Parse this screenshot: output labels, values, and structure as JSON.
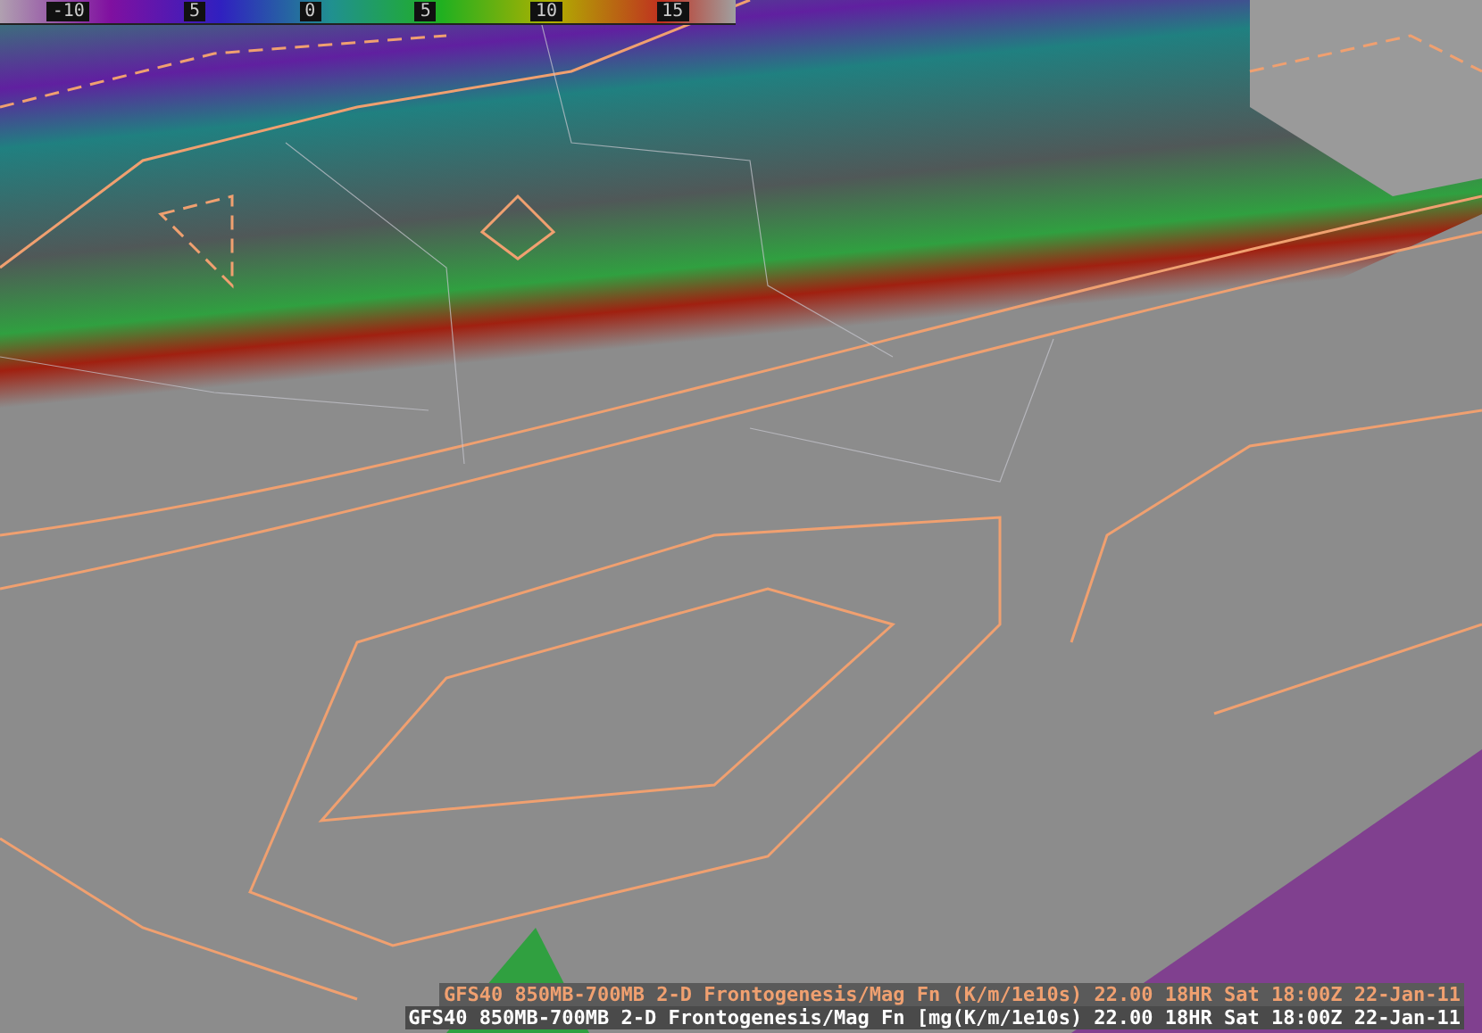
{
  "colorbar": {
    "labels": [
      "-10",
      "5",
      "0",
      "5",
      "10",
      "15"
    ]
  },
  "caption": {
    "ghost": "GFS40 850MB-700MB 2-D Frontogenesis/Mag Fn (K/m/1e10s)  22.00  18HR Sat 18:00Z 22-Jan-11",
    "title": "GFS40 850MB-700MB 2-D Frontogenesis/Mag Fn [mg(K/m/1e10s)  22.00  18HR Sat 18:00Z 22-Jan-11"
  }
}
